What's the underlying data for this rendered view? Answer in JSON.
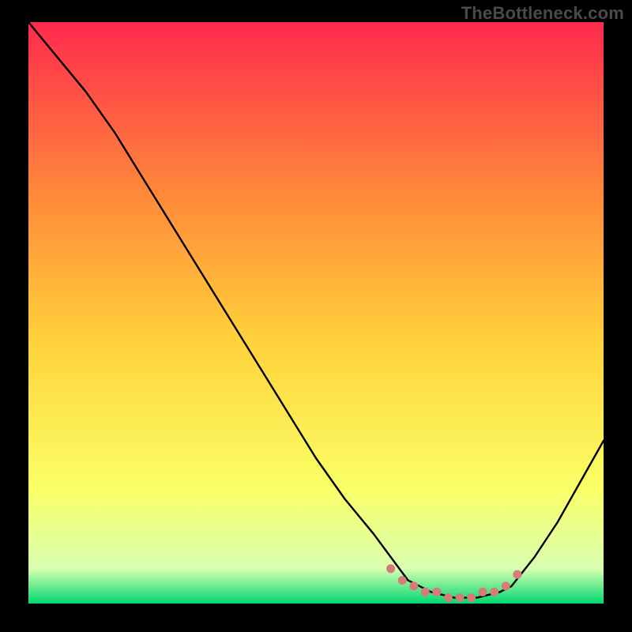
{
  "watermark": "TheBottleneck.com",
  "chart_data": {
    "type": "line",
    "title": "",
    "xlabel": "",
    "ylabel": "",
    "xlim": [
      0,
      100
    ],
    "ylim": [
      0,
      100
    ],
    "grid": false,
    "legend": false,
    "gradient_colors": {
      "top": "#ff2a4d",
      "mid_upper": "#ff8a3a",
      "mid": "#ffd23a",
      "mid_lower": "#faff66",
      "near_bottom": "#d8ffb0",
      "bottom": "#00d870"
    },
    "curve_comment": "V-shaped bottleneck curve; y is bottleneck % (high=bad), x is relative GPU/CPU balance. Curve descends from top-left, reaches minimum near x≈66–84, rises again toward right edge.",
    "series": [
      {
        "name": "bottleneck-curve",
        "stroke": "#000000",
        "x": [
          0,
          5,
          10,
          15,
          20,
          25,
          30,
          35,
          40,
          45,
          50,
          55,
          60,
          63,
          66,
          70,
          74,
          78,
          82,
          84,
          88,
          92,
          96,
          100
        ],
        "y": [
          100,
          94,
          88,
          81,
          73,
          65,
          57,
          49,
          41,
          33,
          25,
          18,
          12,
          8,
          4,
          2,
          1,
          1,
          2,
          3,
          8,
          14,
          21,
          28
        ]
      }
    ],
    "markers": {
      "name": "optimal-range-dots",
      "color": "#d77a7a",
      "x": [
        63,
        65,
        67,
        69,
        71,
        73,
        75,
        77,
        79,
        81,
        83,
        85
      ],
      "y": [
        6,
        4,
        3,
        2,
        2,
        1,
        1,
        1,
        2,
        2,
        3,
        5
      ]
    }
  }
}
